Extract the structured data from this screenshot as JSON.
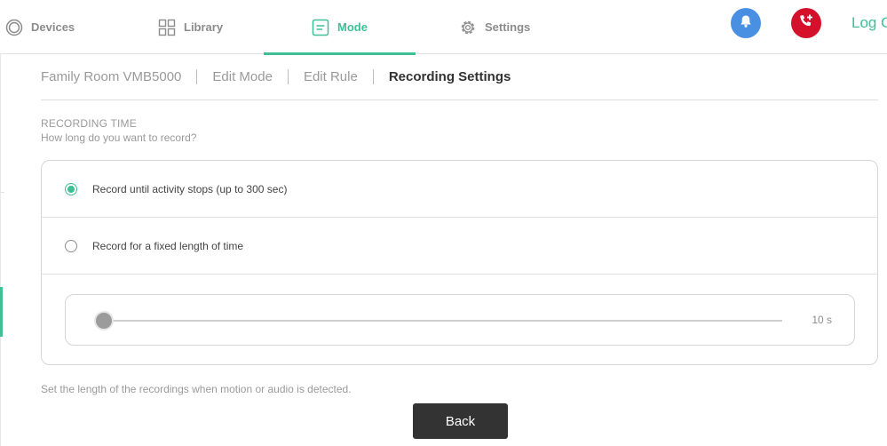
{
  "nav": {
    "devices": "Devices",
    "library": "Library",
    "mode": "Mode",
    "settings": "Settings",
    "logout": "Log O",
    "accent_color": "#3fbf94"
  },
  "breadcrumb": [
    "Family Room VMB5000",
    "Edit Mode",
    "Edit Rule",
    "Recording Settings"
  ],
  "section": {
    "title": "RECORDING TIME",
    "subtitle": "How long do you want to record?"
  },
  "options": [
    {
      "label": "Record until activity stops (up to 300 sec)",
      "selected": true
    },
    {
      "label": "Record for a fixed length of time",
      "selected": false
    }
  ],
  "slider": {
    "value_text": "10 s",
    "position_fraction": 0.0
  },
  "help_text": "Set the length of the recordings when motion or audio is detected.",
  "back_button": "Back",
  "icons": {
    "devices": "devices-icon",
    "library": "grid-icon",
    "mode": "mode-icon",
    "settings": "gear-icon",
    "notifications": "bell-icon",
    "emergency": "phone-plus-icon"
  },
  "colors": {
    "bell_button": "#4a90e2",
    "emergency_button": "#d4102b",
    "back_button": "#333333"
  }
}
